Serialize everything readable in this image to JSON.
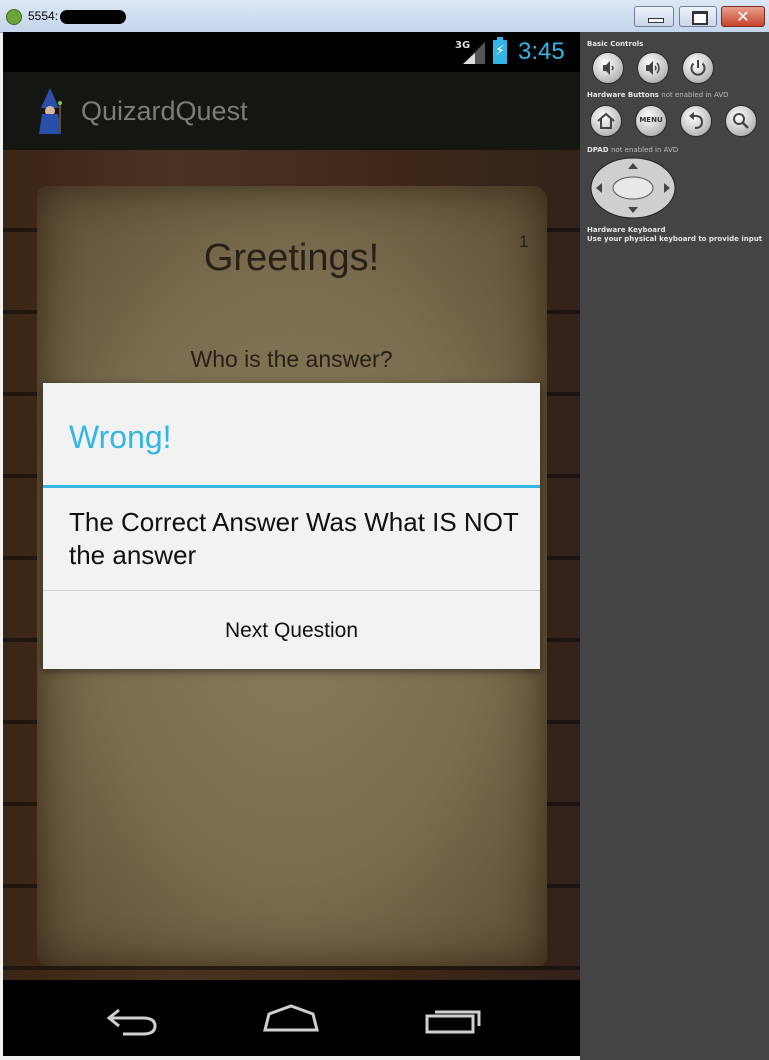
{
  "window": {
    "title": "5554:",
    "minimize_label": "",
    "maximize_label": "",
    "close_label": "✕"
  },
  "status_bar": {
    "network": "3G",
    "clock": "3:45"
  },
  "action_bar": {
    "app_title": "QuizardQuest"
  },
  "quiz": {
    "greeting": "Greetings!",
    "question_number": "1",
    "question": "Who is the answer?"
  },
  "dialog": {
    "title": "Wrong!",
    "message": "The Correct Answer Was What IS NOT the answer",
    "button_label": "Next Question"
  },
  "controls_panel": {
    "basic_controls_label": "Basic Controls",
    "hardware_buttons_label": "Hardware Buttons",
    "hardware_buttons_note": "not enabled in AVD",
    "menu_label": "MENU",
    "dpad_label": "DPAD",
    "dpad_note": "not enabled in AVD",
    "keyboard_label": "Hardware Keyboard",
    "keyboard_note": "Use your physical keyboard to provide input"
  },
  "colors": {
    "accent": "#33b5e5",
    "panel_bg": "#444444",
    "dialog_bg": "#f2f2f2",
    "action_bar_bg": "#141611"
  },
  "icons": {
    "window": [
      "android-app-icon",
      "minimize-icon",
      "maximize-icon",
      "close-icon"
    ],
    "status_bar": [
      "signal-icon",
      "battery-charging-icon"
    ],
    "nav_bar": [
      "back-icon",
      "home-icon",
      "recents-icon"
    ],
    "controls": [
      "volume-down-icon",
      "volume-up-icon",
      "power-icon",
      "home-icon",
      "menu-icon",
      "back-icon",
      "search-icon",
      "dpad-icon"
    ]
  }
}
